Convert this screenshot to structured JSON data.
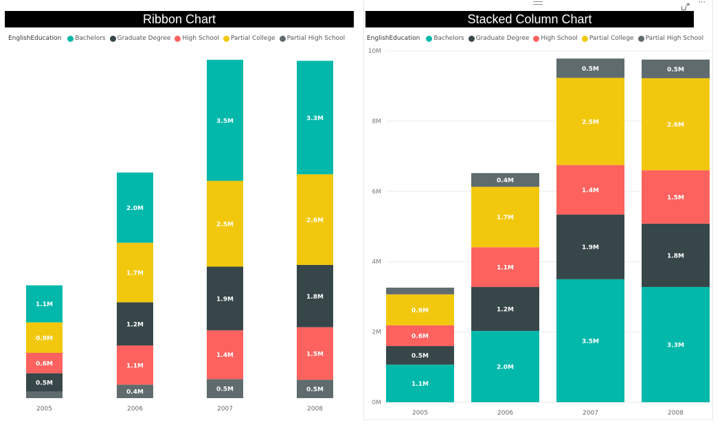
{
  "legend": {
    "title": "EnglishEducation",
    "items": [
      {
        "name": "Bachelors",
        "color": "#01B8AA"
      },
      {
        "name": "Graduate Degree",
        "color": "#374649"
      },
      {
        "name": "High School",
        "color": "#FD625E"
      },
      {
        "name": "Partial College",
        "color": "#F2C80F"
      },
      {
        "name": "Partial High School",
        "color": "#5F6B6D"
      }
    ]
  },
  "visual_header": {
    "drag_handle": "drag-handle",
    "focus_mode": "focus-mode-icon",
    "more_options": "⋯"
  },
  "chart_data": [
    {
      "type": "bar",
      "subtype": "ribbon",
      "title": "Ribbon Chart",
      "legend_title": "EnglishEducation",
      "legend_position": "top-left",
      "categories": [
        "2005",
        "2006",
        "2007",
        "2008"
      ],
      "xlabel": "",
      "ylabel": "",
      "y_axis_visible": false,
      "grid": false,
      "series": [
        {
          "name": "Bachelors",
          "color": "#01B8AA",
          "values": [
            1.07,
            2.03,
            3.5,
            3.28
          ],
          "labels": [
            "1.1M",
            "2.0M",
            "3.5M",
            "3.3M"
          ]
        },
        {
          "name": "Graduate Degree",
          "color": "#374649",
          "values": [
            0.53,
            1.25,
            1.84,
            1.8
          ],
          "labels": [
            "0.5M",
            "1.2M",
            "1.9M",
            "1.8M"
          ]
        },
        {
          "name": "High School",
          "color": "#FD625E",
          "values": [
            0.59,
            1.13,
            1.41,
            1.52
          ],
          "labels": [
            "0.6M",
            "1.1M",
            "1.4M",
            "1.5M"
          ]
        },
        {
          "name": "Partial College",
          "color": "#F2C80F",
          "values": [
            0.88,
            1.72,
            2.48,
            2.62
          ],
          "labels": [
            "0.9M",
            "1.7M",
            "2.5M",
            "2.6M"
          ]
        },
        {
          "name": "Partial High School",
          "color": "#5F6B6D",
          "values": [
            0.19,
            0.39,
            0.55,
            0.53
          ],
          "labels": [
            "",
            "0.4M",
            "0.5M",
            "0.5M"
          ]
        }
      ],
      "stack_order": "ascending-by-value-per-category",
      "units": "millions"
    },
    {
      "type": "bar",
      "subtype": "stacked",
      "title": "Stacked Column Chart",
      "legend_title": "EnglishEducation",
      "legend_position": "top-left",
      "categories": [
        "2005",
        "2006",
        "2007",
        "2008"
      ],
      "xlabel": "",
      "ylabel": "",
      "ylim": [
        0,
        10
      ],
      "yticks": [
        "0M",
        "2M",
        "4M",
        "6M",
        "8M",
        "10M"
      ],
      "grid": true,
      "series": [
        {
          "name": "Bachelors",
          "color": "#01B8AA",
          "values": [
            1.07,
            2.03,
            3.5,
            3.28
          ],
          "labels": [
            "1.1M",
            "2.0M",
            "3.5M",
            "3.3M"
          ]
        },
        {
          "name": "Graduate Degree",
          "color": "#374649",
          "values": [
            0.53,
            1.25,
            1.84,
            1.8
          ],
          "labels": [
            "0.5M",
            "1.2M",
            "1.9M",
            "1.8M"
          ]
        },
        {
          "name": "High School",
          "color": "#FD625E",
          "values": [
            0.59,
            1.13,
            1.41,
            1.52
          ],
          "labels": [
            "0.6M",
            "1.1M",
            "1.4M",
            "1.5M"
          ]
        },
        {
          "name": "Partial College",
          "color": "#F2C80F",
          "values": [
            0.88,
            1.72,
            2.48,
            2.62
          ],
          "labels": [
            "0.9M",
            "1.7M",
            "2.5M",
            "2.6M"
          ]
        },
        {
          "name": "Partial High School",
          "color": "#5F6B6D",
          "values": [
            0.19,
            0.39,
            0.55,
            0.53
          ],
          "labels": [
            "",
            "0.4M",
            "0.5M",
            "0.5M"
          ]
        }
      ],
      "units": "millions"
    }
  ]
}
